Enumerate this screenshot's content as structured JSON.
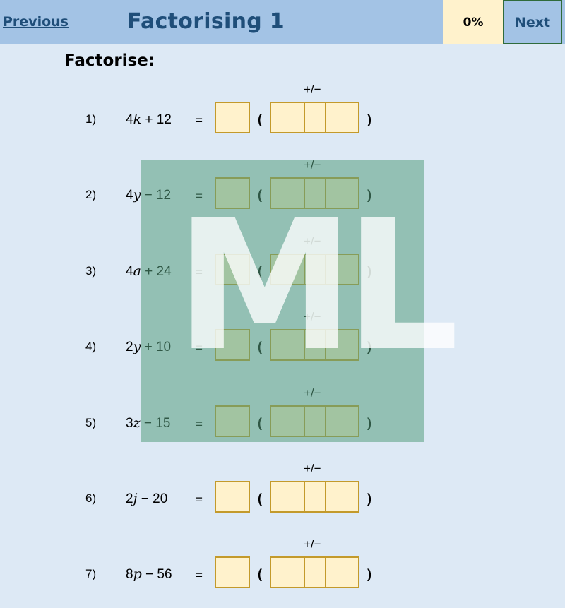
{
  "header": {
    "previous_label": "Previous",
    "title": "Factorising 1",
    "score": "0%",
    "next_label": "Next"
  },
  "instruction": "Factorise:",
  "questions": [
    {
      "num": "1)",
      "coef": "4",
      "var": "k",
      "rest": " + 12",
      "sign_hint": "+/−"
    },
    {
      "num": "2)",
      "coef": "4",
      "var": "y",
      "rest": " − 12",
      "sign_hint": "+/−"
    },
    {
      "num": "3)",
      "coef": "4",
      "var": "a",
      "rest": " + 24",
      "sign_hint": "+/−"
    },
    {
      "num": "4)",
      "coef": "2",
      "var": "y",
      "rest": " + 10",
      "sign_hint": "+/−"
    },
    {
      "num": "5)",
      "coef": "3",
      "var": "z",
      "rest": " − 15",
      "sign_hint": "+/−"
    },
    {
      "num": "6)",
      "coef": "2",
      "var": "j",
      "rest": " − 20",
      "sign_hint": "+/−"
    },
    {
      "num": "7)",
      "coef": "8",
      "var": "p",
      "rest": " − 56",
      "sign_hint": "+/−"
    }
  ],
  "symbols": {
    "equals": "=",
    "open_paren": "(",
    "close_paren": ")"
  },
  "watermark": "ML",
  "colors": {
    "page_bg": "#dde9f5",
    "header_bg": "#a3c3e5",
    "title_text": "#1f4e79",
    "answer_box_fill": "#fff2cc",
    "answer_box_border": "#c39a2b",
    "watermark_bg": "#569e7e"
  }
}
